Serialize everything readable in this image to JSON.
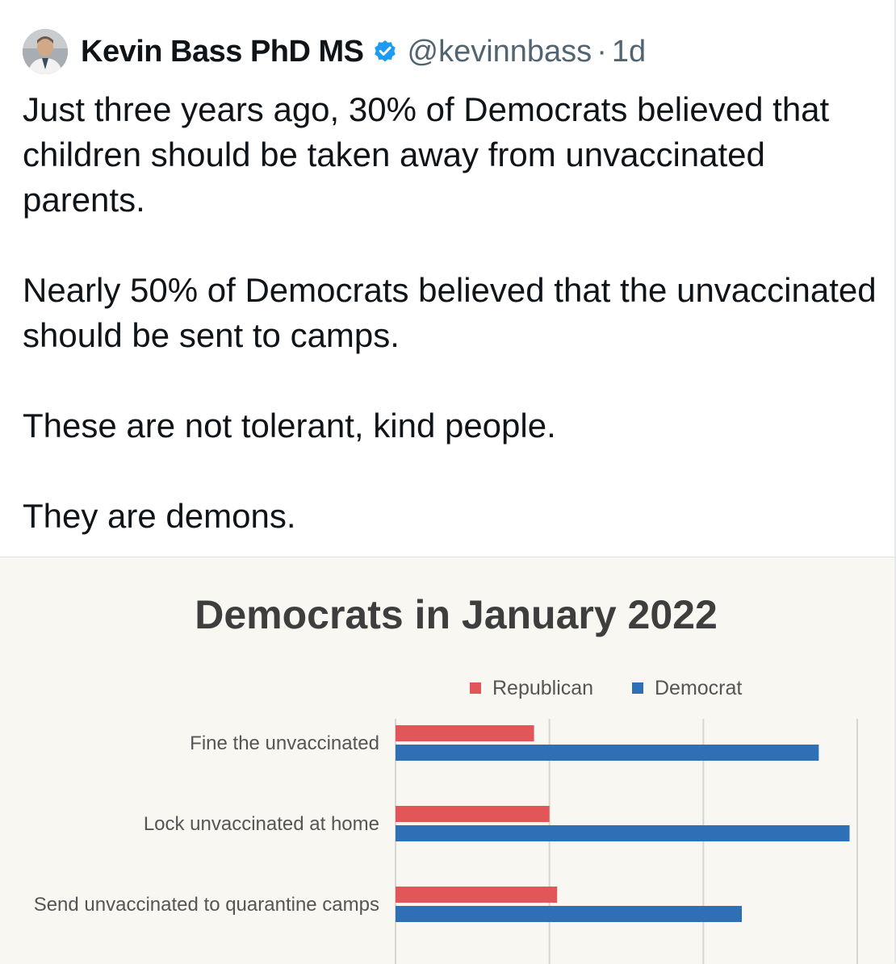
{
  "tweet": {
    "display_name": "Kevin Bass PhD MS",
    "verified_icon": "verified-badge-icon",
    "handle": "@kevinnbass",
    "separator": "·",
    "timestamp": "1d",
    "paragraphs": [
      "Just three years ago, 30% of Democrats believed that children should be taken away from unvaccinated parents.",
      "Nearly 50% of Democrats believed that the unvaccinated should be sent to camps.",
      "These are not tolerant, kind people.",
      "They are demons."
    ]
  },
  "colors": {
    "verified": "#1d9bf0",
    "republican": "#e25558",
    "democrat": "#2f6fb6",
    "chart_background": "#f8f7f1"
  },
  "chart_data": {
    "type": "bar",
    "orientation": "horizontal",
    "title": "Democrats in January 2022",
    "categories": [
      "Fine the unvaccinated",
      "Lock unvaccinated at home",
      "Send unvaccinated to quarantine camps"
    ],
    "series": [
      {
        "name": "Republican",
        "values": [
          18,
          20,
          21
        ]
      },
      {
        "name": "Democrat",
        "values": [
          55,
          59,
          45
        ]
      }
    ],
    "xlim": [
      0,
      60
    ],
    "grid": true,
    "legend": "top-right"
  }
}
